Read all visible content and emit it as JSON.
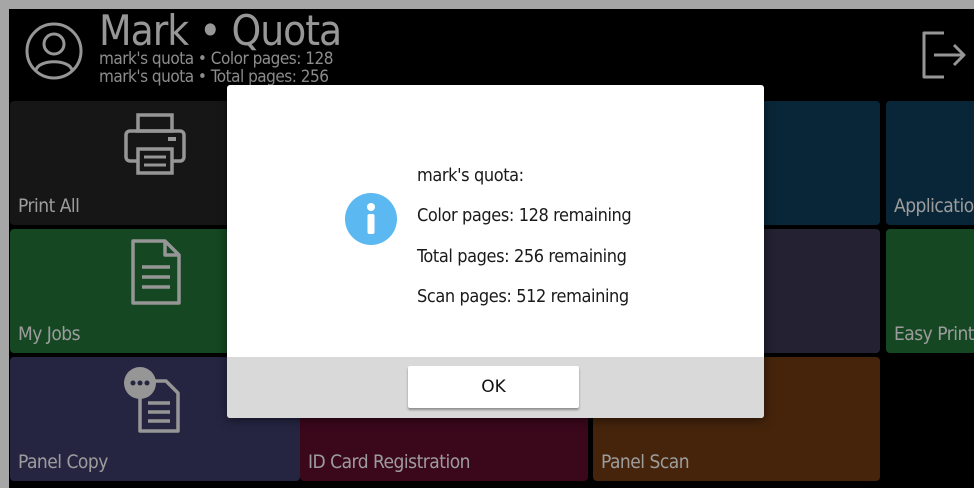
{
  "header": {
    "user_name": "Mark • Quota",
    "quota_line_1": "mark's quota • Color pages: 128",
    "quota_line_2": "mark's quota • Total pages: 256",
    "avatar_icon": "user-circle-icon",
    "logout_icon": "logout-icon"
  },
  "tiles": {
    "print_all": {
      "label": "Print All",
      "icon": "printer-icon",
      "color": "#222222"
    },
    "applications": {
      "label": "Applications",
      "color": "#0e3b57"
    },
    "my_jobs": {
      "label": "My Jobs",
      "icon": "document-icon",
      "color": "#1f6e35"
    },
    "easy_print": {
      "label": "Easy Print",
      "color": "#1f6e35"
    },
    "panel_copy": {
      "label": "Panel Copy",
      "icon": "copy-icon",
      "color": "#3a3a66"
    },
    "id_card": {
      "label": "ID Card Registration",
      "color": "#5b0b2a"
    },
    "panel_scan": {
      "label": "Panel Scan",
      "color": "#6a3812"
    }
  },
  "dialog": {
    "icon": "info-icon",
    "title": "mark's quota:",
    "color_pages": "Color pages: 128 remaining",
    "total_pages": "Total pages: 256 remaining",
    "scan_pages": "Scan pages: 512 remaining",
    "ok_label": "OK",
    "accent_color": "#5bb8f0"
  }
}
